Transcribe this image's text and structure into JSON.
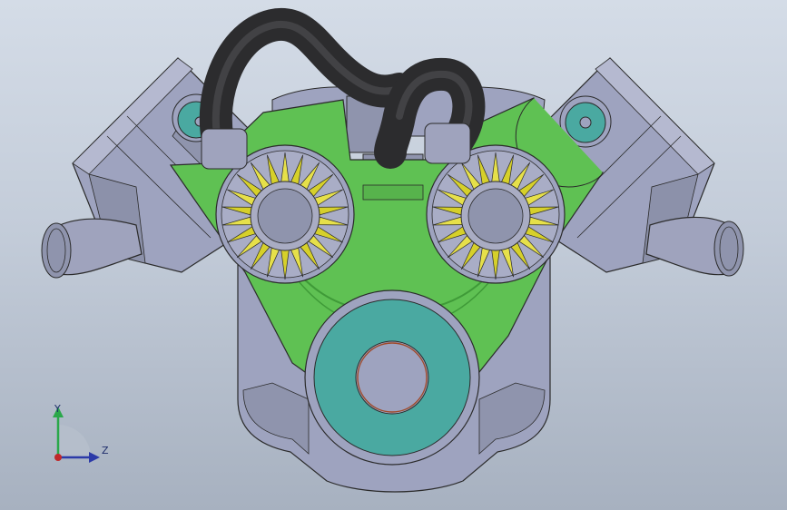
{
  "viewport": {
    "background_top": "#d4dce7",
    "background_bottom": "#a7b1c0"
  },
  "model": {
    "description_hidden": "",
    "colors": {
      "block": "#9ea3bf",
      "block_dark": "#7f8499",
      "outline": "#2b2b2b",
      "cover_green": "#5fc153",
      "cover_green_dark": "#3f9a38",
      "teal": "#4aa9a1",
      "hose": "#2c2c2e",
      "hose_highlight": "#55565a",
      "gear_yellow": "#d6d02a",
      "gear_dark": "#8c8a1a",
      "hub": "#a9acc3",
      "bore": "#6e7488",
      "port_pipe": "#9fa3bd"
    }
  },
  "triad": {
    "y_label": "Y",
    "z_label": "Z",
    "colors": {
      "y": "#2aa84a",
      "z": "#2c3aa8",
      "x": "#c0282a"
    }
  }
}
